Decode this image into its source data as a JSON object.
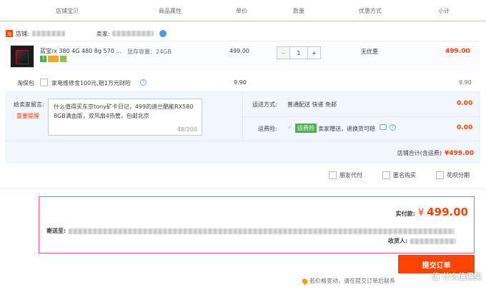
{
  "columns": [
    "店铺宝贝",
    "商品属性",
    "单价",
    "数量",
    "优惠方式",
    "小计"
  ],
  "shop": {
    "shop_label": "店铺:",
    "seller_label": "卖家:"
  },
  "item": {
    "title": "蓝宝rx 380 4G 480 8g 570 ...",
    "attr": "显存容量：24GB",
    "price": "499.00",
    "qty": "1",
    "qty_minus": "−",
    "qty_plus": "+",
    "discount": "无优惠",
    "subtotal": "499.00",
    "badge_7": "7"
  },
  "insurance": {
    "label": "淘保包",
    "option": "家电维修金100元,赔1万元财险",
    "price": "9.90",
    "subtotal": "9.90"
  },
  "message": {
    "label": "给卖家留言:",
    "reminder": "重要提醒",
    "text": "什么值得买东京tony矿卡日记，499的迪兰酷能RX580 8GB满血版，双风扇4热管，包邮北京",
    "count": "48/200"
  },
  "shipping": {
    "label": "运送方式:",
    "value": "普通配送 快递 免邮",
    "fee": "0.00"
  },
  "freight_ins": {
    "label": "运费险:",
    "tag": "运费险",
    "desc": "卖家赠送，退换货可赔",
    "fee": "0.00"
  },
  "shop_total": {
    "label": "店铺合计(含运费)",
    "value": "¥499.00"
  },
  "options": [
    "朋友代付",
    "匿名购买",
    "花呗分期"
  ],
  "summary": {
    "paid_label": "实付款:",
    "currency": "¥",
    "amount": "499.00",
    "ship_to_label": "寄送至:",
    "receiver_label": "收货人:"
  },
  "submit_label": "提交订单",
  "notice": "若价格变动，请在提交订单后联系",
  "watermark": "值 什么值得买",
  "colors": {
    "accent": "#ff4400",
    "header_line": "#b2d1ff",
    "summary_border": "#ff5d88"
  }
}
